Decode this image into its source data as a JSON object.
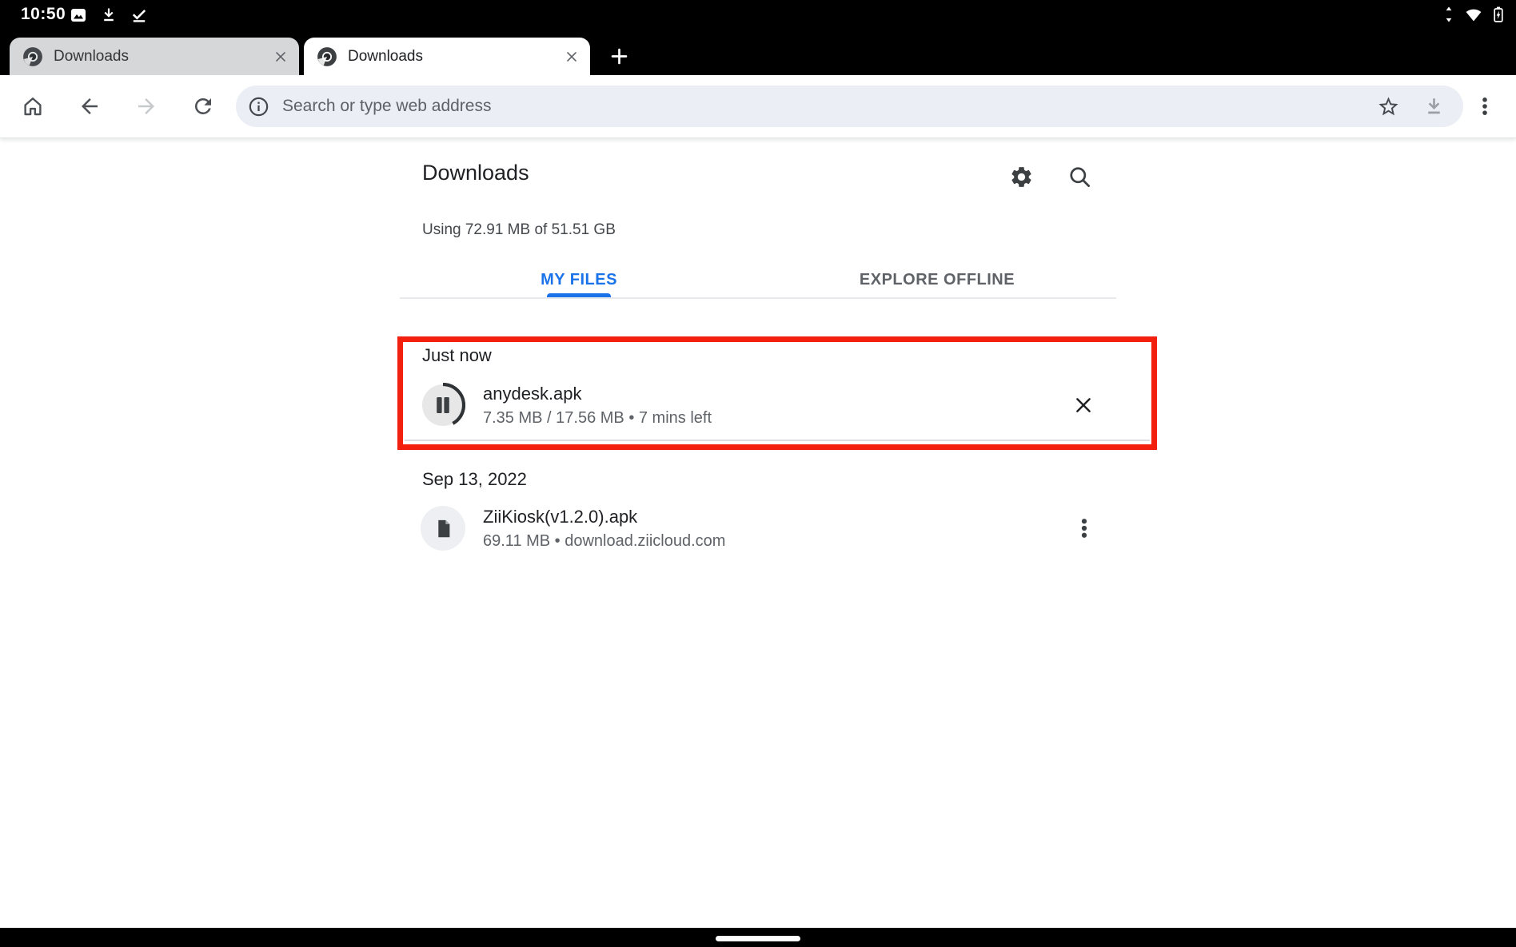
{
  "status_bar": {
    "time": "10:50",
    "left_icons": [
      "image-notification",
      "download-notification",
      "check-notification"
    ],
    "right_icons": [
      "network-activity",
      "wifi",
      "battery-charging"
    ]
  },
  "tab_strip": {
    "tabs": [
      {
        "label": "Downloads",
        "active": false
      },
      {
        "label": "Downloads",
        "active": true
      }
    ]
  },
  "toolbar": {
    "address_placeholder": "Search or type web address"
  },
  "page": {
    "title": "Downloads",
    "storage_summary": "Using 72.91 MB of 51.51 GB",
    "filter_tabs": [
      {
        "label": "MY FILES",
        "active": true
      },
      {
        "label": "EXPLORE OFFLINE",
        "active": false
      }
    ],
    "groups": [
      {
        "header": "Just now",
        "highlighted": true,
        "items": [
          {
            "name": "anydesk.apk",
            "meta": "7.35 MB / 17.56 MB • 7 mins left",
            "state": "downloading-paused",
            "progress_percent": 42
          }
        ]
      },
      {
        "header": "Sep 13, 2022",
        "highlighted": false,
        "items": [
          {
            "name": "ZiiKiosk(v1.2.0).apk",
            "meta": "69.11 MB • download.ziicloud.com",
            "state": "complete"
          }
        ]
      }
    ]
  },
  "colors": {
    "accent_blue": "#1a73e8",
    "highlight_red": "#f3200f",
    "text_primary": "#202124",
    "text_secondary": "#5f6368"
  }
}
